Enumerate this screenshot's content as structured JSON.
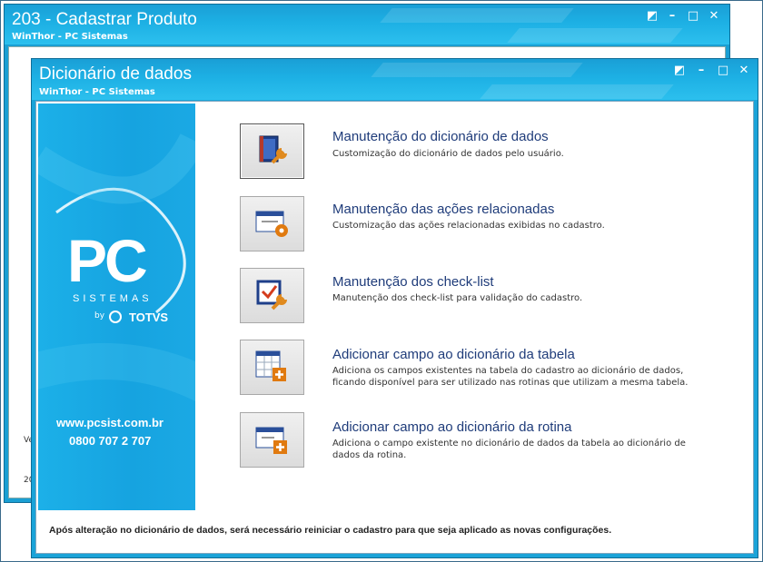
{
  "back_window": {
    "title": "203 - Cadastrar  Produto",
    "subtitle": "WinThor - PC Sistemas",
    "frag_1": "Ve",
    "frag_2": "20"
  },
  "front_window": {
    "title": "Dicionário de dados",
    "subtitle": "WinThor - PC Sistemas"
  },
  "banner": {
    "logo_text": "PC",
    "logo_sub": "SISTEMAS",
    "by": "by",
    "totvs": "TOTVS",
    "url": "www.pcsist.com.br",
    "phone": "0800 707 2 707"
  },
  "options": [
    {
      "title": "Manutenção do dicionário de dados",
      "desc": "Customização do dicionário de dados pelo usuário.",
      "icon": "book-wrench-icon"
    },
    {
      "title": "Manutenção das ações relacionadas",
      "desc": "Customização das ações relacionadas exibidas no cadastro.",
      "icon": "window-gear-icon"
    },
    {
      "title": "Manutenção dos check-list",
      "desc": "Manutenção dos check-list para validação do cadastro.",
      "icon": "checklist-wrench-icon"
    },
    {
      "title": "Adicionar campo ao dicionário da tabela",
      "desc": "Adiciona os campos existentes na tabela do cadastro ao dicionário de dados, ficando disponível para ser utilizado nas rotinas que utilizam a mesma tabela.",
      "icon": "table-add-icon"
    },
    {
      "title": "Adicionar campo ao dicionário da rotina",
      "desc": "Adiciona o campo existente no dicionário de dados da tabela ao dicionário de dados da rotina.",
      "icon": "window-add-icon"
    }
  ],
  "footer_note": "Após alteração no dicionário de dados, será necessário reiniciar o cadastro para que seja aplicado as novas configurações.",
  "colors": {
    "titlebar": "#1aa3d8",
    "option_title": "#1f3c7a",
    "banner": "#16a3e0"
  }
}
